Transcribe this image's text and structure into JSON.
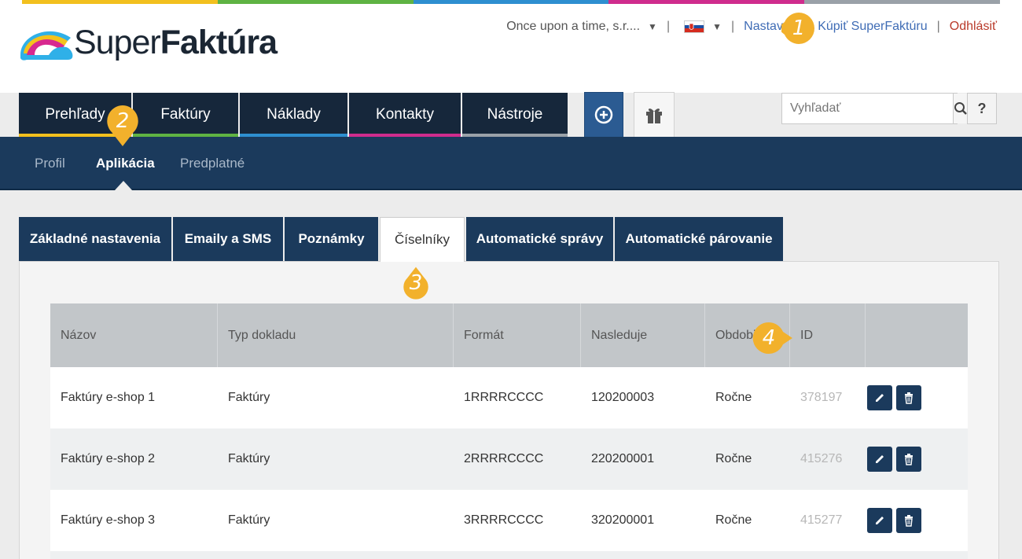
{
  "brand": {
    "light": "Super",
    "bold": "Faktúra"
  },
  "colors": {
    "navy": "#1b3a5c",
    "dark": "#16273b",
    "accent_orange": "#f2b12c"
  },
  "topnav": {
    "company": "Once upon a time, s.r....",
    "separator": "|",
    "settings": "Nastavenia",
    "buy": "Kúpiť SuperFaktúru",
    "logout": "Odhlásiť"
  },
  "maintabs": [
    "Prehľady",
    "Faktúry",
    "Náklady",
    "Kontakty",
    "Nástroje"
  ],
  "search": {
    "placeholder": "Vyhľadať"
  },
  "help": "?",
  "subnav": [
    "Profil",
    "Aplikácia",
    "Predplatné"
  ],
  "content_tabs": [
    "Základné nastavenia",
    "Emaily a SMS",
    "Poznámky",
    "Číselníky",
    "Automatické správy",
    "Automatické párovanie"
  ],
  "table": {
    "headers": [
      "Názov",
      "Typ dokladu",
      "Formát",
      "Nasleduje",
      "Obdobie",
      "ID",
      ""
    ],
    "rows": [
      [
        "Faktúry e-shop 1",
        "Faktúry",
        "1RRRRCCCC",
        "120200003",
        "Ročne",
        "378197"
      ],
      [
        "Faktúry e-shop 2",
        "Faktúry",
        "2RRRRCCCC",
        "220200001",
        "Ročne",
        "415276"
      ],
      [
        "Faktúry e-shop 3",
        "Faktúry",
        "3RRRRCCCC",
        "320200001",
        "Ročne",
        "415277"
      ]
    ]
  },
  "badges": [
    "1",
    "2",
    "3",
    "4"
  ],
  "icons": [
    "caret-down-icon",
    "flag-sk-icon",
    "plus-circle-icon",
    "gift-icon",
    "search-icon",
    "pencil-icon",
    "trash-icon"
  ]
}
